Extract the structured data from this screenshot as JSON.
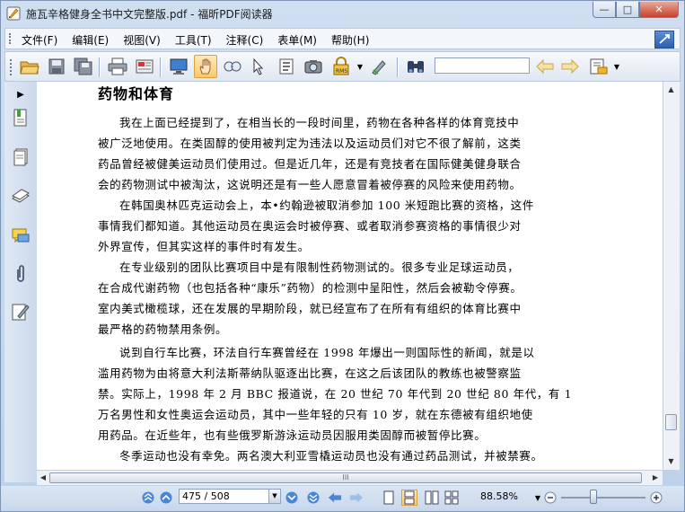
{
  "window": {
    "title": "施瓦辛格健身全书中文完整版.pdf - 福昕PDF阅读器"
  },
  "menu": {
    "items": [
      "文件(F)",
      "编辑(E)",
      "视图(V)",
      "工具(T)",
      "注释(C)",
      "表单(M)",
      "帮助(H)"
    ]
  },
  "toolbar": {
    "icons": [
      "open-folder",
      "save",
      "save-as",
      "print",
      "email",
      "fullscreen",
      "hand-tool",
      "snapshot-zoom",
      "select-arrow",
      "text-select",
      "camera",
      "rms-lock",
      "sign-pen",
      "binoculars",
      "prev-search",
      "next-search",
      "highlight"
    ],
    "search_value": ""
  },
  "document": {
    "heading": "药物和体育",
    "paragraphs": [
      {
        "lines": [
          "我在上面已经提到了，在相当长的一段时间里，药物在各种各样的体育竞技中",
          "被广泛地使用。在类固醇的使用被判定为违法以及运动员们对它不很了解前，这类",
          "药品曾经被健美运动员们使用过。但是近几年，还是有竞技者在国际健美健身联合",
          "会的药物测试中被淘汰，这说明还是有一些人愿意冒着被停赛的风险来使用药物。"
        ]
      },
      {
        "lines": [
          "在韩国奥林匹克运动会上，本•约翰逊被取消参加 100 米短跑比赛的资格，这件",
          "事情我们都知道。其他运动员在奥运会时被停赛、或者取消参赛资格的事情很少对",
          "外界宣传，但其实这样的事件时有发生。"
        ]
      },
      {
        "lines": [
          "在专业级别的团队比赛项目中是有限制性药物测试的。很多专业足球运动员，",
          "在合成代谢药物（也包括各种“康乐”药物）的检测中呈阳性，然后会被勒令停赛。",
          "室内美式橄榄球，还在发展的早期阶段，就已经宣布了在所有有组织的体育比赛中",
          "最严格的药物禁用条例。"
        ]
      },
      {
        "lines": [
          "说到自行车比赛，环法自行车赛曾经在 1998 年爆出一则国际性的新闻，就是以",
          "滥用药物为由将意大利法斯蒂纳队驱逐出比赛，在这之后该团队的教练也被警察监",
          "禁。实际上，1998 年 2 月 BBC 报道说，在 20 世纪 70 年代到 20 世纪 80 年代，有 1",
          "万名男性和女性奥运会运动员，其中一些年轻的只有 10 岁，就在东德被有组织地使",
          "用药品。在近些年，也有些俄罗斯游泳运动员因服用类固醇而被暂停比赛。"
        ]
      },
      {
        "lines": [
          "冬季运动也没有幸免。两名澳大利亚雪橇运动员也没有通过药品测试，并被禁赛。"
        ]
      }
    ]
  },
  "status": {
    "page_value": "475 / 508",
    "zoom": "88.58%",
    "hscroll_grip": "III"
  }
}
